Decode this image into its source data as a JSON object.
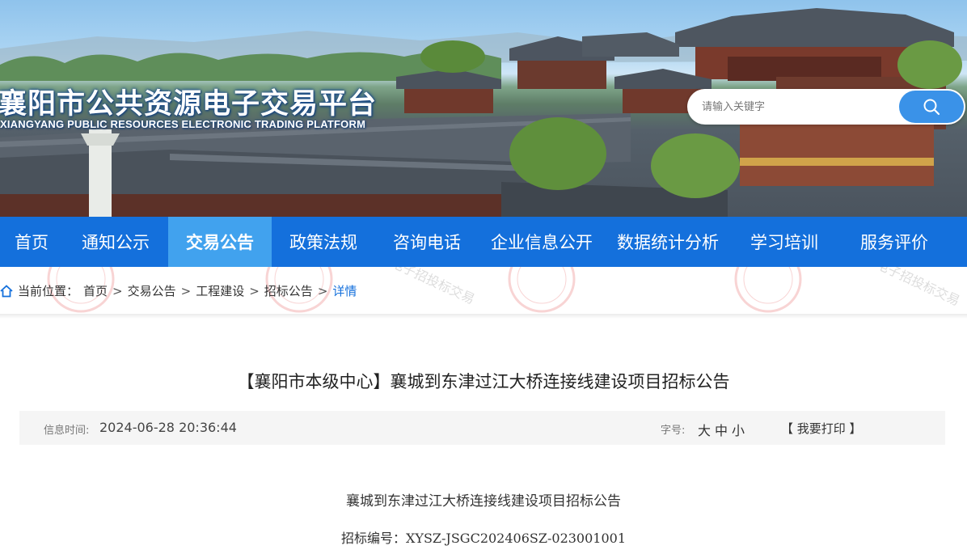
{
  "header": {
    "title": "襄阳市公共资源电子交易平台",
    "subtitle": "XIANGYANG PUBLIC RESOURCES ELECTRONIC TRADING PLATFORM",
    "search_placeholder": "请输入关键字",
    "search_icon": "search-icon"
  },
  "nav": {
    "items": [
      {
        "label": "首页"
      },
      {
        "label": "通知公示"
      },
      {
        "label": "交易公告",
        "active": true
      },
      {
        "label": "政策法规"
      },
      {
        "label": "咨询电话"
      },
      {
        "label": "企业信息公开"
      },
      {
        "label": "数据统计分析"
      },
      {
        "label": "学习培训"
      },
      {
        "label": "服务评价"
      }
    ],
    "active_color": "#41a2ee",
    "bar_color": "#1470dc"
  },
  "breadcrumb": {
    "icon": "home-icon",
    "prefix": "当前位置：",
    "items": [
      "首页",
      "交易公告",
      "工程建设",
      "招标公告"
    ],
    "separator": ">",
    "current": "详情",
    "watermark_text": "电子招投标交易"
  },
  "article": {
    "title": "【襄阳市本级中心】襄城到东津过江大桥连接线建设项目招标公告",
    "time_label": "信息时间:",
    "time_value": "2024-06-28 20:36:44",
    "font_label": "字号:",
    "font_sizes": [
      "大",
      "中",
      "小"
    ],
    "print_label": "【 我要打印 】",
    "body_title": "襄城到东津过江大桥连接线建设项目招标公告",
    "bid_no": "招标编号：XYSZ-JSGC202406SZ-023001001"
  }
}
